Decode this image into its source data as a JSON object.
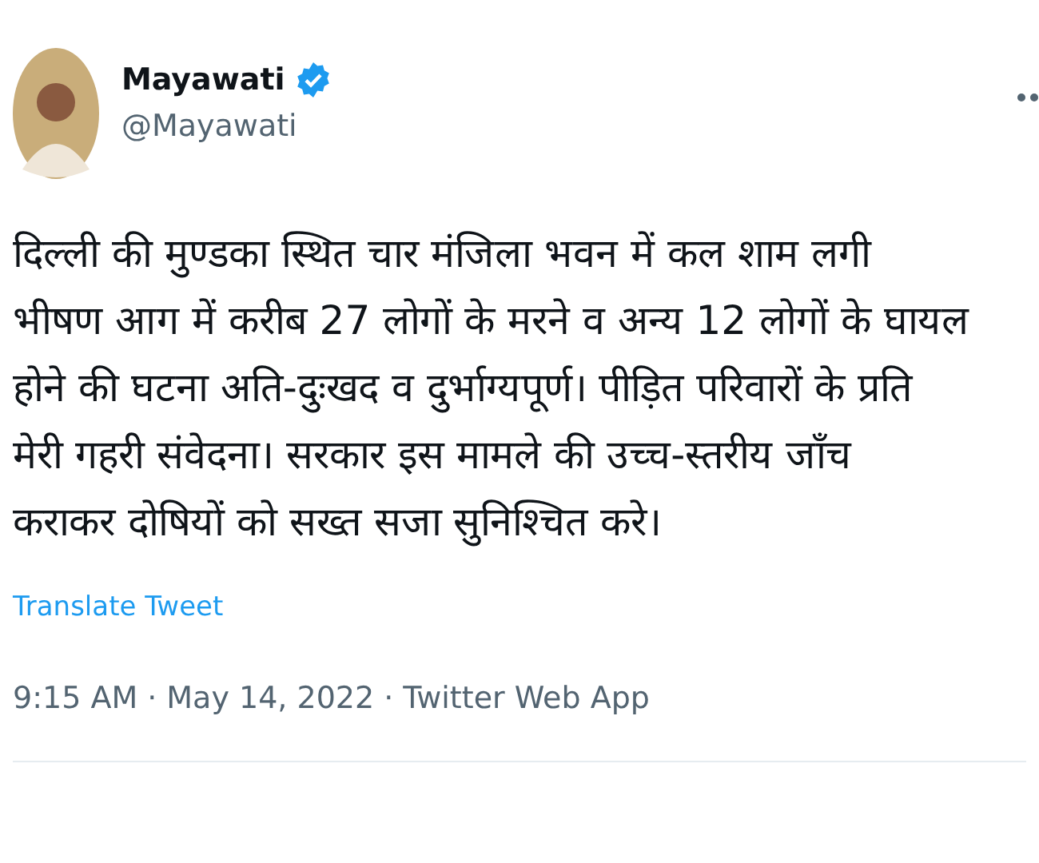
{
  "author": {
    "name": "Mayawati",
    "verified": true,
    "handle": "@Mayawati"
  },
  "text": "दिल्ली की मुण्डका स्थित चार मंजिला भवन में कल शाम लगी\nभीषण आग में करीब 27 लोगों के मरने व अन्य 12 लोगों के घायल\nहोने की घटना अति-दुःखद व दुर्भाग्यपूर्ण। पीड़ित परिवारों के प्रति\nमेरी गहरी संवेदना। सरकार इस मामले की उच्च-स्तरीय जाँच\nकराकर दोषियों को सख्त सजा सुनिश्चित करे।",
  "translate_link": "Translate Tweet",
  "meta": {
    "time": "9:15 AM",
    "separator_1": "·",
    "date": "May 14, 2022",
    "separator_2": "·",
    "source": "Twitter Web App"
  }
}
